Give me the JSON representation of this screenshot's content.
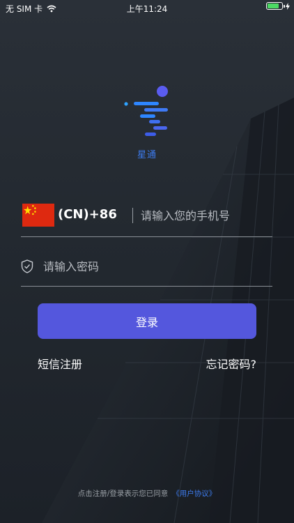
{
  "status_bar": {
    "carrier": "无 SIM 卡",
    "time": "上午11:24",
    "battery_level": 0.8,
    "icons": [
      "wifi-icon",
      "battery-icon",
      "charging-icon"
    ]
  },
  "app": {
    "logo_text": "星通",
    "brand_color": "#3d7cf0"
  },
  "phone": {
    "country_code": "(CN)+86",
    "flag": "china-flag-icon",
    "placeholder": "请输入您的手机号"
  },
  "password": {
    "placeholder": "请输入密码",
    "icon": "shield-icon"
  },
  "login_button": {
    "label": "登录",
    "color": "#5457dd"
  },
  "links": {
    "register": "短信注册",
    "forgot": "忘记密码?"
  },
  "agreement": {
    "text": "点击注册/登录表示您已同意",
    "link": "《用户协议》"
  }
}
